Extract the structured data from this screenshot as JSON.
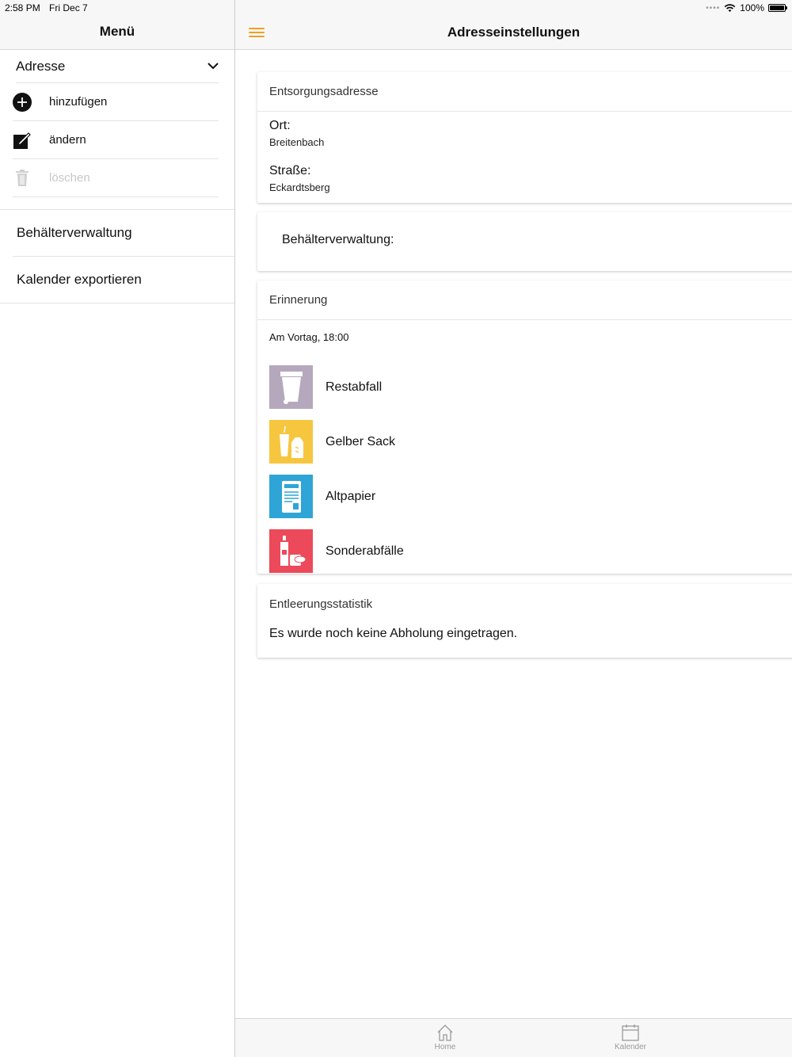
{
  "status": {
    "time": "2:58 PM",
    "date": "Fri Dec 7",
    "battery": "100%"
  },
  "sidebar": {
    "title": "Menü",
    "address": {
      "label": "Adresse",
      "items": [
        {
          "label": "hinzufügen",
          "icon": "plus-circle-icon"
        },
        {
          "label": "ändern",
          "icon": "edit-icon"
        },
        {
          "label": "löschen",
          "icon": "trash-icon",
          "disabled": true
        }
      ]
    },
    "container_management": "Behälterverwaltung",
    "export_calendar": "Kalender exportieren"
  },
  "header": {
    "title": "Adresseinstellungen"
  },
  "disposal_address": {
    "heading": "Entsorgungsadresse",
    "city_label": "Ort:",
    "city_value": "Breitenbach",
    "street_label": "Straße:",
    "street_value": "Eckardtsberg"
  },
  "container_card": {
    "label": "Behälterverwaltung:"
  },
  "reminder": {
    "heading": "Erinnerung",
    "when": "Am Vortag, 18:00",
    "types": [
      {
        "label": "Restabfall",
        "color": "#b5a8bd",
        "icon": "trash-bin-icon"
      },
      {
        "label": "Gelber Sack",
        "color": "#f7c63f",
        "icon": "packaging-icon"
      },
      {
        "label": "Altpapier",
        "color": "#2ea5d6",
        "icon": "paper-icon"
      },
      {
        "label": "Sonderabfälle",
        "color": "#ec4a5a",
        "icon": "hazardous-icon"
      }
    ]
  },
  "statistics": {
    "heading": "Entleerungsstatistik",
    "empty_text": "Es wurde noch keine Abholung eingetragen."
  },
  "tabs": [
    {
      "label": "Home",
      "icon": "home-icon"
    },
    {
      "label": "Kalender",
      "icon": "calendar-icon"
    }
  ],
  "colors": {
    "accent": "#f0a020"
  }
}
